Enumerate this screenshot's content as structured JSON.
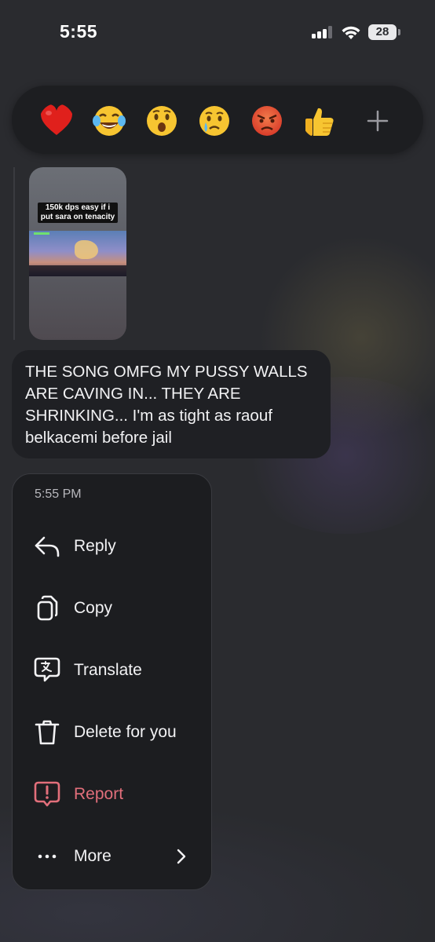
{
  "status_bar": {
    "time": "5:55",
    "battery": "28"
  },
  "reactions": [
    {
      "icon": "red-heart-icon",
      "glyph": "❤️"
    },
    {
      "icon": "face-with-tears-of-joy-icon",
      "glyph": "😂"
    },
    {
      "icon": "face-with-open-mouth-icon",
      "glyph": "😮"
    },
    {
      "icon": "crying-face-icon",
      "glyph": "😢"
    },
    {
      "icon": "angry-face-icon",
      "glyph": "😡"
    },
    {
      "icon": "thumbs-up-icon",
      "glyph": "👍"
    },
    {
      "icon": "plus-icon",
      "glyph": "+"
    }
  ],
  "media": {
    "caption": "150k dps easy if i put sara on tenacity"
  },
  "message": {
    "text": "THE SONG OMFG MY PUSSY WALLS ARE CAVING IN... THEY ARE SHRINKING... I'm as tight as raouf belkacemi before jail"
  },
  "menu": {
    "time": "5:55 PM",
    "items": [
      {
        "label": "Reply",
        "icon": "reply-arrow-icon"
      },
      {
        "label": "Copy",
        "icon": "copy-icon"
      },
      {
        "label": "Translate",
        "icon": "translate-icon"
      },
      {
        "label": "Delete for you",
        "icon": "trash-icon"
      },
      {
        "label": "Report",
        "icon": "report-icon",
        "color": "#e26f7b"
      },
      {
        "label": "More",
        "icon": "more-dots-icon"
      }
    ]
  }
}
